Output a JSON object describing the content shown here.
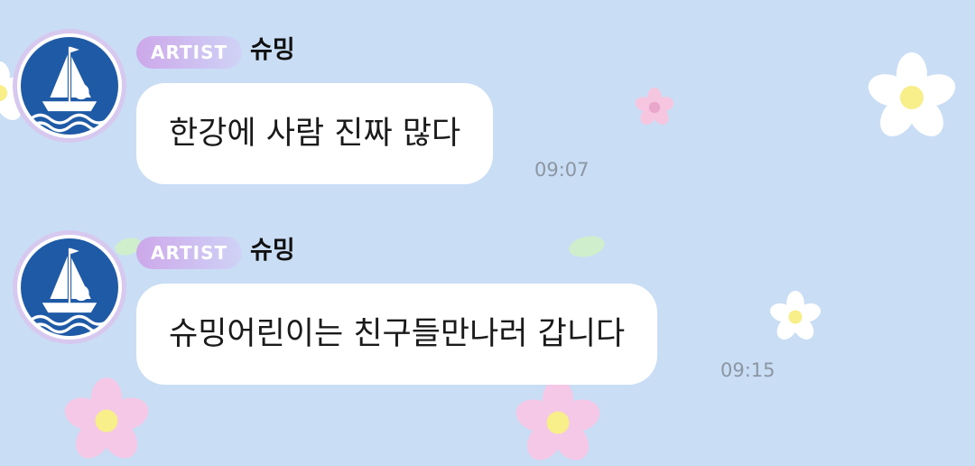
{
  "messages": [
    {
      "badge": "ARTIST",
      "sender": "슈밍",
      "text": "한강에 사람 진짜 많다",
      "time": "09:07"
    },
    {
      "badge": "ARTIST",
      "sender": "슈밍",
      "text": "슈밍어린이는 친구들만나러 갑니다",
      "time": "09:15"
    }
  ],
  "colors": {
    "background": "#c9def4",
    "bubble": "#ffffff",
    "badge_gradient_start": "#cda8ea",
    "badge_gradient_end": "#cfd2f6",
    "timestamp": "#8c96a3"
  },
  "icons": {
    "avatar": "sailor-ship-avatar-icon",
    "decoration": "flower-icon"
  }
}
